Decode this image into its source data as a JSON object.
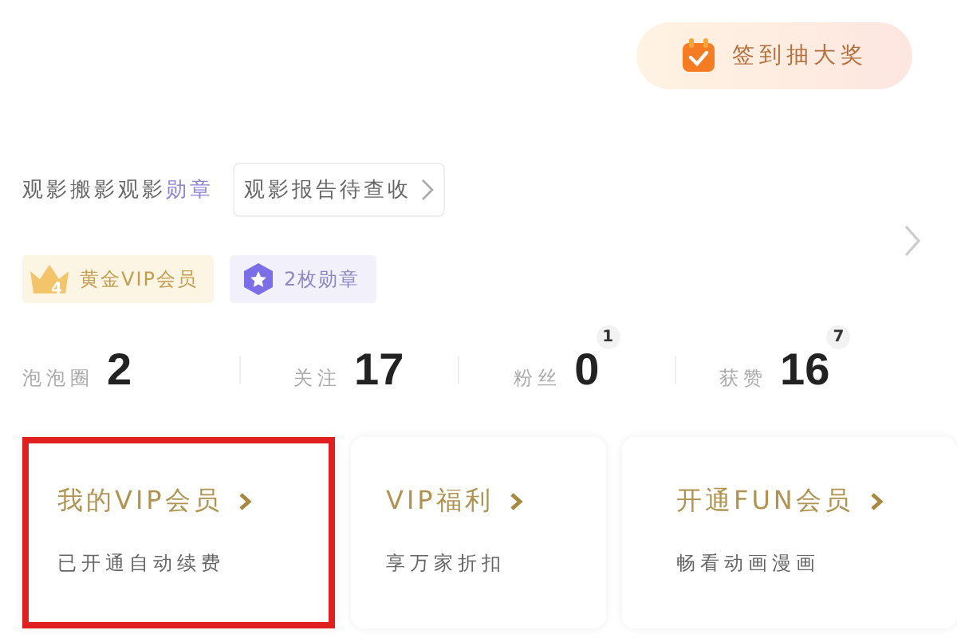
{
  "signin_button": {
    "label": "签到抽大奖"
  },
  "medal_line": {
    "label": "观影搬影观影",
    "medal": "勋章"
  },
  "report_link": {
    "label": "观影报告待查收"
  },
  "badges": [
    {
      "kind": "vip",
      "level_text": "4",
      "label": "黄金VIP会员"
    },
    {
      "kind": "medal",
      "label": "2枚勋章"
    }
  ],
  "stats": [
    {
      "label": "泡泡圈",
      "value": "2"
    },
    {
      "label": "关注",
      "value": "17"
    },
    {
      "label": "粉丝",
      "value": "0",
      "badge": "1"
    },
    {
      "label": "获赞",
      "value": "16",
      "badge": "7"
    }
  ],
  "cards": [
    {
      "title": "我的VIP会员",
      "subtitle": "已开通自动续费",
      "selected": true
    },
    {
      "title": "VIP福利",
      "subtitle": "享万家折扣",
      "selected": false
    },
    {
      "title": "开通FUN会员",
      "subtitle": "畅看动画漫画",
      "selected": false
    }
  ]
}
